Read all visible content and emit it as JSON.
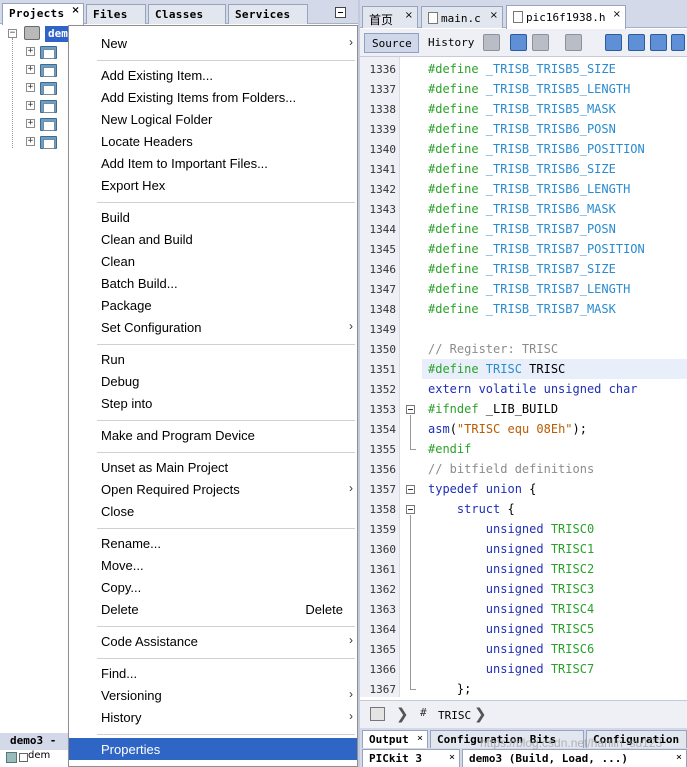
{
  "left_tabs": [
    {
      "label": "Projects",
      "close": "×"
    },
    {
      "label": "Files"
    },
    {
      "label": "Classes"
    },
    {
      "label": "Services"
    }
  ],
  "tree": {
    "root_label": "dem"
  },
  "context_menu": {
    "items": [
      {
        "label": "New",
        "submenu": true
      },
      {
        "label": "Add Existing Item..."
      },
      {
        "label": "Add Existing Items from Folders..."
      },
      {
        "label": "New Logical Folder"
      },
      {
        "label": "Locate Headers"
      },
      {
        "label": "Add Item to Important Files..."
      },
      {
        "label": "Export Hex"
      },
      {
        "label": "Build"
      },
      {
        "label": "Clean and Build"
      },
      {
        "label": "Clean"
      },
      {
        "label": "Batch Build..."
      },
      {
        "label": "Package"
      },
      {
        "label": "Set Configuration",
        "submenu": true
      },
      {
        "label": "Run"
      },
      {
        "label": "Debug"
      },
      {
        "label": "Step into"
      },
      {
        "label": "Make and Program Device"
      },
      {
        "label": "Unset as Main Project"
      },
      {
        "label": "Open Required Projects",
        "submenu": true
      },
      {
        "label": "Close"
      },
      {
        "label": "Rename..."
      },
      {
        "label": "Move..."
      },
      {
        "label": "Copy..."
      },
      {
        "label": "Delete",
        "shortcut": "Delete"
      },
      {
        "label": "Code Assistance",
        "submenu": true
      },
      {
        "label": "Find..."
      },
      {
        "label": "Versioning",
        "submenu": true
      },
      {
        "label": "History",
        "submenu": true
      },
      {
        "label": "Properties",
        "selected": true
      }
    ],
    "submenu_arrow": "›"
  },
  "editor_tabs": [
    {
      "label": "首页",
      "close": "×"
    },
    {
      "label": "main.c",
      "close": "×"
    },
    {
      "label": "pic16f1938.h",
      "close": "×",
      "active": true
    }
  ],
  "editor_toolbar": {
    "source": "Source",
    "history": "History"
  },
  "code_lines": [
    {
      "n": "1336",
      "parts": [
        [
          "dir",
          "#define "
        ],
        [
          "mac",
          "_TRISB_TRISB5_SIZE"
        ]
      ]
    },
    {
      "n": "1337",
      "parts": [
        [
          "dir",
          "#define "
        ],
        [
          "mac",
          "_TRISB_TRISB5_LENGTH"
        ]
      ]
    },
    {
      "n": "1338",
      "parts": [
        [
          "dir",
          "#define "
        ],
        [
          "mac",
          "_TRISB_TRISB5_MASK"
        ]
      ]
    },
    {
      "n": "1339",
      "parts": [
        [
          "dir",
          "#define "
        ],
        [
          "mac",
          "_TRISB_TRISB6_POSN"
        ]
      ]
    },
    {
      "n": "1340",
      "parts": [
        [
          "dir",
          "#define "
        ],
        [
          "mac",
          "_TRISB_TRISB6_POSITION"
        ]
      ]
    },
    {
      "n": "1341",
      "parts": [
        [
          "dir",
          "#define "
        ],
        [
          "mac",
          "_TRISB_TRISB6_SIZE"
        ]
      ]
    },
    {
      "n": "1342",
      "parts": [
        [
          "dir",
          "#define "
        ],
        [
          "mac",
          "_TRISB_TRISB6_LENGTH"
        ]
      ]
    },
    {
      "n": "1343",
      "parts": [
        [
          "dir",
          "#define "
        ],
        [
          "mac",
          "_TRISB_TRISB6_MASK"
        ]
      ]
    },
    {
      "n": "1344",
      "parts": [
        [
          "dir",
          "#define "
        ],
        [
          "mac",
          "_TRISB_TRISB7_POSN"
        ]
      ]
    },
    {
      "n": "1345",
      "parts": [
        [
          "dir",
          "#define "
        ],
        [
          "mac",
          "_TRISB_TRISB7_POSITION"
        ]
      ]
    },
    {
      "n": "1346",
      "parts": [
        [
          "dir",
          "#define "
        ],
        [
          "mac",
          "_TRISB_TRISB7_SIZE"
        ]
      ]
    },
    {
      "n": "1347",
      "parts": [
        [
          "dir",
          "#define "
        ],
        [
          "mac",
          "_TRISB_TRISB7_LENGTH"
        ]
      ]
    },
    {
      "n": "1348",
      "parts": [
        [
          "dir",
          "#define "
        ],
        [
          "mac",
          "_TRISB_TRISB7_MASK"
        ]
      ]
    },
    {
      "n": "1349",
      "parts": []
    },
    {
      "n": "1350",
      "parts": [
        [
          "com",
          "// Register: TRISC"
        ]
      ]
    },
    {
      "n": "1351",
      "parts": [
        [
          "dir",
          "#define "
        ],
        [
          "mac",
          "TRISC"
        ],
        [
          "id",
          " TRISC"
        ]
      ],
      "highlight": true
    },
    {
      "n": "1352",
      "parts": [
        [
          "kw",
          "extern volatile unsigned char"
        ]
      ]
    },
    {
      "n": "1353",
      "parts": [
        [
          "dir",
          "#ifndef "
        ],
        [
          "id",
          "_LIB_BUILD"
        ]
      ],
      "fold": "open"
    },
    {
      "n": "1354",
      "parts": [
        [
          "kw",
          "asm"
        ],
        [
          "id",
          "("
        ],
        [
          "str",
          "\"TRISC equ 08Eh\""
        ],
        [
          "id",
          ");"
        ]
      ]
    },
    {
      "n": "1355",
      "parts": [
        [
          "dir",
          "#endif"
        ]
      ],
      "fold": "end"
    },
    {
      "n": "1356",
      "parts": [
        [
          "com",
          "// bitfield definitions"
        ]
      ]
    },
    {
      "n": "1357",
      "parts": [
        [
          "kw",
          "typedef union"
        ],
        [
          "id",
          " {"
        ]
      ],
      "fold": "open"
    },
    {
      "n": "1358",
      "parts": [
        [
          "kw",
          "    struct"
        ],
        [
          "id",
          " {"
        ]
      ],
      "fold": "open"
    },
    {
      "n": "1359",
      "parts": [
        [
          "kw",
          "        unsigned "
        ],
        [
          "dir",
          "TRISC0"
        ]
      ]
    },
    {
      "n": "1360",
      "parts": [
        [
          "kw",
          "        unsigned "
        ],
        [
          "dir",
          "TRISC1"
        ]
      ]
    },
    {
      "n": "1361",
      "parts": [
        [
          "kw",
          "        unsigned "
        ],
        [
          "dir",
          "TRISC2"
        ]
      ]
    },
    {
      "n": "1362",
      "parts": [
        [
          "kw",
          "        unsigned "
        ],
        [
          "dir",
          "TRISC3"
        ]
      ]
    },
    {
      "n": "1363",
      "parts": [
        [
          "kw",
          "        unsigned "
        ],
        [
          "dir",
          "TRISC4"
        ]
      ]
    },
    {
      "n": "1364",
      "parts": [
        [
          "kw",
          "        unsigned "
        ],
        [
          "dir",
          "TRISC5"
        ]
      ]
    },
    {
      "n": "1365",
      "parts": [
        [
          "kw",
          "        unsigned "
        ],
        [
          "dir",
          "TRISC6"
        ]
      ]
    },
    {
      "n": "1366",
      "parts": [
        [
          "kw",
          "        unsigned "
        ],
        [
          "dir",
          "TRISC7"
        ]
      ]
    },
    {
      "n": "1367",
      "parts": [
        [
          "id",
          "    };"
        ]
      ],
      "fold": "end"
    }
  ],
  "breadcrumb": {
    "icon_text": "#",
    "label": "TRISC"
  },
  "output_tabs": [
    {
      "label": "Output",
      "close": "×"
    },
    {
      "label": "Configuration Bits"
    },
    {
      "label": "Configuration"
    },
    {
      "label": "PICkit 3",
      "close": "×"
    },
    {
      "label": "demo3 (Build, Load, ...)",
      "close": "×"
    }
  ],
  "bottom_left": {
    "tab_label": "demo3 - ",
    "row_label": "dem"
  },
  "watermark": "https://blog.csdn.net/hanlin_su123",
  "colors": {
    "selection": "#2f65c4",
    "directive": "#2aa22a",
    "macro": "#2a8bd0",
    "comment": "#8c8c8c",
    "keyword": "#1f2fb6",
    "string": "#b85c00"
  }
}
